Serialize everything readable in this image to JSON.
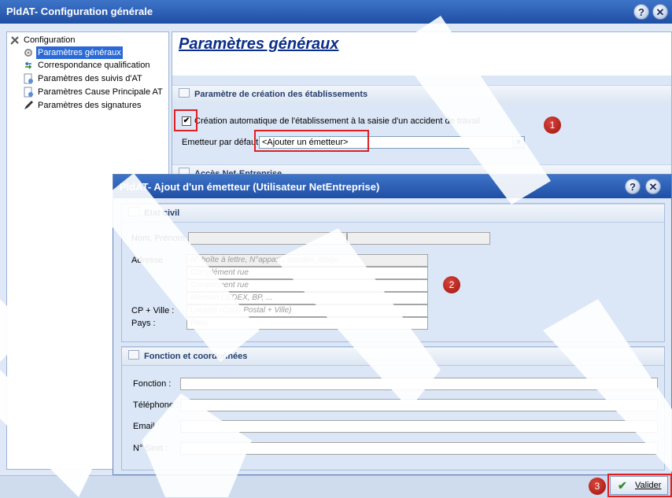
{
  "main_window": {
    "title": "PldAT- Configuration générale",
    "help_label": "?",
    "close_label": "✕"
  },
  "tree": {
    "root": "Configuration",
    "items": [
      {
        "label": "Paramètres généraux",
        "selected": true,
        "icon": "gear-icon"
      },
      {
        "label": "Correspondance qualification",
        "icon": "arrows-icon"
      },
      {
        "label": "Paramètres des suivis d'AT",
        "icon": "document-icon"
      },
      {
        "label": "Paramètres Cause Principale AT",
        "icon": "document-icon"
      },
      {
        "label": "Paramètres des signatures",
        "icon": "pen-icon"
      }
    ]
  },
  "content": {
    "heading": "Paramètres généraux",
    "group1_title": "Paramètre de création des établissements",
    "checkbox_label": "Création automatique de l'établissement à la saisie d'un accident de travail",
    "checkbox_checked": true,
    "emetteur_label": "Emetteur par défaut",
    "emetteur_value": "<Ajouter un émetteur>",
    "group2_title_partial": "Accès Net-Entreprise"
  },
  "badges": {
    "one": "1",
    "two": "2",
    "three": "3"
  },
  "dialog": {
    "title": "PldAT- Ajout d'un émetteur (Utilisateur NetEntreprise)",
    "help_label": "?",
    "close_label": "✕",
    "etat_civil_title": "Etat civil",
    "nom_prenom_label": "Nom, Prénom :",
    "adresse_label": "Adresse",
    "address_placeholders": [
      "N° boîte à lettre, N°appart., escalier, étage",
      "Complément rue",
      "Complément rue",
      "Mention CEDEX, BP, ..."
    ],
    "cp_ville_label": "CP + Ville :",
    "cp_ville_placeholder": "Localité (Code Postal + Ville)",
    "pays_label": "Pays :",
    "pays_placeholder": "Pays",
    "fonction_group_title": "Fonction et coordonnées",
    "fonction_label": "Fonction :",
    "telephone_label": "Téléphone :",
    "email_label": "Email :",
    "siret_label": "N° Siret :"
  },
  "footer": {
    "valider_label": "Valider",
    "valider_mnemonic": "V"
  },
  "colors": {
    "titlebar": "#2a5db5",
    "panel": "#dbe6f7",
    "highlight_red": "#e02020",
    "badge": "#b01c14",
    "selection": "#2b6ad6"
  }
}
